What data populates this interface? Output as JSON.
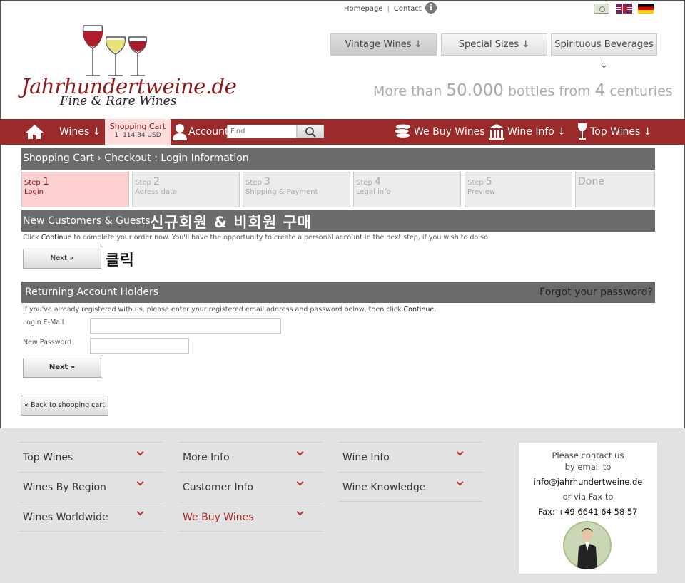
{
  "header": {
    "top_links": [
      "Homepage",
      "Contact"
    ],
    "separator": "|",
    "nav_buttons": [
      "Vintage Wines ↓",
      "Special Sizes ↓",
      "Spirituous Beverages ↓"
    ],
    "tagline": {
      "prefix": "More than ",
      "count": "50.000",
      "middle": " bottles from ",
      "num": "4",
      "suffix": " centuries"
    }
  },
  "logo": {
    "title": "Jahrhundertweine.de",
    "subtitle": "Fine & Rare Wines"
  },
  "navbar": {
    "wines": "Wines ↓",
    "cart_label": "Shopping Cart",
    "cart_count": "1",
    "cart_total": "114.84 USD",
    "account": "Account",
    "search_placeholder": "Find",
    "we_buy": "We Buy Wines",
    "wine_info": "Wine Info ↓",
    "top_wines": "Top Wines ↓"
  },
  "checkout": {
    "title": "Shopping Cart › Checkout : Login Information",
    "steps": [
      {
        "n": "1",
        "label": "Login",
        "prefix": "Step"
      },
      {
        "n": "2",
        "label": "Adress data",
        "prefix": "Step"
      },
      {
        "n": "3",
        "label": "Shipping & Payment",
        "prefix": "Step"
      },
      {
        "n": "4",
        "label": "Legal info",
        "prefix": "Step"
      },
      {
        "n": "5",
        "label": "Preview",
        "prefix": "Step"
      },
      {
        "n": "",
        "label": "",
        "prefix": "Done"
      }
    ]
  },
  "new_customers": {
    "title": "New Customers & Guests",
    "korean_overlay": "신규회원 & 비회원 구매",
    "text_pre": "Click ",
    "text_bold": "Continue",
    "text_post": " to complete your order now. You'll have the opportunity to create a personal account in the next step, if you wish to do so.",
    "next_label": "Next »",
    "korean_click": "클릭"
  },
  "returning": {
    "title": "Returning Account Holders",
    "forgot": "Forgot your password?",
    "text_pre": "If you've already registered with us, please enter your registered email address and password below, then click ",
    "text_bold": "Continue",
    "text_post": ".",
    "email_label": "Login E-Mail",
    "password_label": "New Password",
    "next_label": "Next »"
  },
  "back_label": "« Back to shopping cart",
  "footer": {
    "col1": [
      "Top Wines",
      "Wines By Region",
      "Wines Worldwide"
    ],
    "col2": [
      "More Info",
      "Customer Info",
      "We Buy Wines"
    ],
    "col3": [
      "Wine Info",
      "Wine Knowledge"
    ],
    "contact": {
      "line1": "Please contact us",
      "line2": "by email to",
      "email": "info@jahrhundertweine.de",
      "line3": "or via Fax to",
      "fax": "Fax: +49 6641 64 58 57"
    }
  },
  "colors": {
    "brand_red": "#9b2a2a",
    "panel_gray": "#6b6b6b",
    "step_active": "#fcd0d0"
  }
}
